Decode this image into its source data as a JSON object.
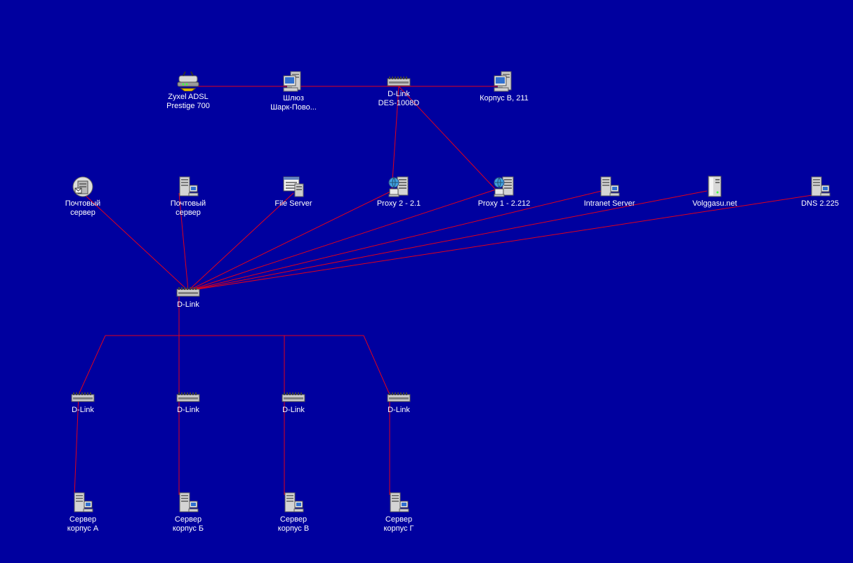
{
  "colors": {
    "background": "#00009f",
    "link": "#e0001c",
    "label": "#ffffff"
  },
  "nodes": [
    {
      "id": "zyxel",
      "icon": "modem-icon",
      "lines": [
        "Zyxel ADSL",
        "Prestige 700"
      ]
    },
    {
      "id": "gateway",
      "icon": "workstation-icon",
      "lines": [
        "Шлюз",
        "Шарк-Пово..."
      ]
    },
    {
      "id": "dlink_top",
      "icon": "switch-icon",
      "lines": [
        "D-Link",
        "DES-1008D"
      ]
    },
    {
      "id": "korpus_v211",
      "icon": "workstation-icon",
      "lines": [
        "Корпус В, 211"
      ]
    },
    {
      "id": "mail1",
      "icon": "mail-server-icon",
      "lines": [
        "Почтовый",
        "сервер"
      ]
    },
    {
      "id": "mail2",
      "icon": "server-icon",
      "lines": [
        "Почтовый",
        "сервер"
      ]
    },
    {
      "id": "fileserver",
      "icon": "file-server-icon",
      "lines": [
        "File Server"
      ]
    },
    {
      "id": "proxy2",
      "icon": "proxy-icon",
      "lines": [
        "Proxy 2 - 2.1"
      ]
    },
    {
      "id": "proxy1",
      "icon": "proxy-icon",
      "lines": [
        "Proxy 1 - 2.212"
      ]
    },
    {
      "id": "intranet",
      "icon": "server-icon",
      "lines": [
        "Intranet Server"
      ]
    },
    {
      "id": "volggasu",
      "icon": "tower-icon",
      "lines": [
        "Volggasu.net"
      ]
    },
    {
      "id": "dns",
      "icon": "server-icon",
      "lines": [
        "DNS 2.225"
      ]
    },
    {
      "id": "dlink_core",
      "icon": "switch-icon",
      "lines": [
        "D-Link"
      ]
    },
    {
      "id": "dlink_a",
      "icon": "switch-icon",
      "lines": [
        "D-Link"
      ]
    },
    {
      "id": "dlink_b",
      "icon": "switch-icon",
      "lines": [
        "D-Link"
      ]
    },
    {
      "id": "dlink_v",
      "icon": "switch-icon",
      "lines": [
        "D-Link"
      ]
    },
    {
      "id": "dlink_g",
      "icon": "switch-icon",
      "lines": [
        "D-Link"
      ]
    },
    {
      "id": "srv_a",
      "icon": "server-icon",
      "lines": [
        "Сервер",
        "корпус А"
      ]
    },
    {
      "id": "srv_b",
      "icon": "server-icon",
      "lines": [
        "Сервер",
        "корпус Б"
      ]
    },
    {
      "id": "srv_v",
      "icon": "server-icon",
      "lines": [
        "Сервер",
        "корпус В"
      ]
    },
    {
      "id": "srv_g",
      "icon": "server-icon",
      "lines": [
        "Сервер",
        "корпус Г"
      ]
    }
  ],
  "links": [
    [
      "zyxel",
      "gateway"
    ],
    [
      "gateway",
      "dlink_top"
    ],
    [
      "dlink_top",
      "korpus_v211"
    ],
    [
      "dlink_top",
      "proxy2"
    ],
    [
      "dlink_top",
      "proxy1"
    ],
    [
      "dlink_core",
      "mail1"
    ],
    [
      "dlink_core",
      "mail2"
    ],
    [
      "dlink_core",
      "fileserver"
    ],
    [
      "dlink_core",
      "proxy2"
    ],
    [
      "dlink_core",
      "proxy1"
    ],
    [
      "dlink_core",
      "intranet"
    ],
    [
      "dlink_core",
      "volggasu"
    ],
    [
      "dlink_core",
      "dns"
    ],
    [
      "dlink_core",
      "dlink_a"
    ],
    [
      "dlink_core",
      "dlink_b"
    ],
    [
      "dlink_core",
      "dlink_v"
    ],
    [
      "dlink_core",
      "dlink_g"
    ],
    [
      "dlink_a",
      "srv_a"
    ],
    [
      "dlink_b",
      "srv_b"
    ],
    [
      "dlink_v",
      "srv_v"
    ],
    [
      "dlink_g",
      "srv_g"
    ]
  ]
}
